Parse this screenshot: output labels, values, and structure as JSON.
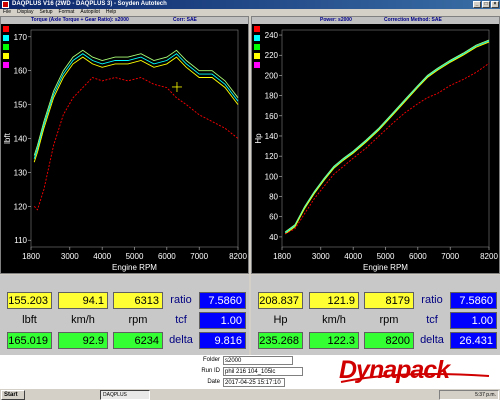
{
  "window": {
    "title": "DAQPLUS V16 (2WD - DAQPLUS 3) - Soyden Autotech"
  },
  "menu": [
    "File",
    "Display",
    "Setup",
    "Format",
    "Autopilot",
    "Help"
  ],
  "left_chart": {
    "header_title": "Torque (Axle Torque + Gear Ratio): s2000",
    "header_corr": "Corr: SAE"
  },
  "right_chart": {
    "header_title": "Power: s2000",
    "header_corr": "Correction Method: SAE"
  },
  "chart_data": [
    {
      "type": "line",
      "title": "",
      "xlabel": "Engine RPM",
      "ylabel": "lbft",
      "xlim": [
        1800,
        8200
      ],
      "ylim": [
        108,
        172
      ],
      "x_ticks": [
        1800,
        3000,
        4000,
        5000,
        6000,
        7000,
        8200
      ],
      "y_ticks": [
        110,
        120,
        130,
        140,
        150,
        160,
        170
      ],
      "legend_colors": [
        "#ff0000",
        "#00ffff",
        "#00ff00",
        "#ffff00",
        "#ff00ff"
      ],
      "series": [
        {
          "color": "#aaff77",
          "x": [
            1900,
            2000,
            2200,
            2500,
            2800,
            3100,
            3400,
            3700,
            4000,
            4400,
            4800,
            5200,
            5600,
            6000,
            6300,
            6600,
            7000,
            7400,
            7800,
            8200
          ],
          "y": [
            135,
            138,
            145,
            154,
            160,
            164,
            166,
            164,
            163,
            164,
            164,
            165,
            163,
            164,
            166,
            163,
            160,
            160,
            157,
            152
          ]
        },
        {
          "color": "#00ffff",
          "x": [
            1900,
            2000,
            2200,
            2500,
            2800,
            3100,
            3400,
            3700,
            4000,
            4400,
            4800,
            5200,
            5600,
            6000,
            6300,
            6600,
            7000,
            7400,
            7800,
            8200
          ],
          "y": [
            134,
            137,
            144,
            153,
            159,
            163,
            165,
            163,
            162,
            163,
            163,
            164,
            162,
            163,
            165,
            162,
            159,
            159,
            156,
            151
          ]
        },
        {
          "color": "#ffff00",
          "x": [
            1900,
            2000,
            2200,
            2500,
            2800,
            3100,
            3400,
            3700,
            4000,
            4400,
            4800,
            5200,
            5600,
            6000,
            6300,
            6600,
            7000,
            7400,
            7800,
            8200
          ],
          "y": [
            133,
            136,
            143,
            152,
            158,
            162,
            164,
            162,
            161,
            162,
            162,
            163,
            161,
            162,
            164,
            161,
            158,
            158,
            155,
            150
          ]
        },
        {
          "color": "#ff0000",
          "dashed": true,
          "x": [
            1900,
            2000,
            2200,
            2500,
            2800,
            3100,
            3400,
            3700,
            4000,
            4400,
            4800,
            5200,
            5600,
            6000,
            6300,
            6600,
            7000,
            7400,
            7800,
            8200
          ],
          "y": [
            120,
            119,
            125,
            138,
            147,
            152,
            155,
            158,
            157,
            158,
            157,
            158,
            156,
            155,
            152,
            150,
            147,
            145,
            143,
            140
          ]
        }
      ]
    },
    {
      "type": "line",
      "title": "",
      "xlabel": "Engine RPM",
      "ylabel": "Hp",
      "xlim": [
        1800,
        8200
      ],
      "ylim": [
        30,
        245
      ],
      "x_ticks": [
        1800,
        3000,
        4000,
        5000,
        6000,
        7000,
        8200
      ],
      "y_ticks": [
        40,
        60,
        80,
        100,
        120,
        140,
        160,
        180,
        200,
        220,
        240
      ],
      "legend_colors": [
        "#ff0000",
        "#00ffff",
        "#00ff00",
        "#ffff00",
        "#ff00ff"
      ],
      "series": [
        {
          "color": "#aaff77",
          "x": [
            1900,
            2200,
            2500,
            2800,
            3100,
            3400,
            3700,
            4000,
            4400,
            4800,
            5200,
            5600,
            6000,
            6300,
            6600,
            7000,
            7400,
            7800,
            8200
          ],
          "y": [
            45,
            52,
            70,
            85,
            98,
            110,
            118,
            125,
            136,
            148,
            162,
            176,
            190,
            200,
            207,
            215,
            222,
            230,
            235
          ]
        },
        {
          "color": "#00ffff",
          "x": [
            1900,
            2200,
            2500,
            2800,
            3100,
            3400,
            3700,
            4000,
            4400,
            4800,
            5200,
            5600,
            6000,
            6300,
            6600,
            7000,
            7400,
            7800,
            8200
          ],
          "y": [
            44,
            51,
            69,
            84,
            97,
            109,
            117,
            124,
            135,
            147,
            161,
            175,
            189,
            199,
            206,
            214,
            221,
            229,
            234
          ]
        },
        {
          "color": "#ffff00",
          "x": [
            1900,
            2200,
            2500,
            2800,
            3100,
            3400,
            3700,
            4000,
            4400,
            4800,
            5200,
            5600,
            6000,
            6300,
            6600,
            7000,
            7400,
            7800,
            8200
          ],
          "y": [
            43,
            50,
            68,
            83,
            96,
            108,
            116,
            123,
            134,
            146,
            160,
            174,
            188,
            198,
            205,
            213,
            220,
            228,
            233
          ]
        },
        {
          "color": "#ff0000",
          "dashed": true,
          "x": [
            1900,
            2200,
            2500,
            2800,
            3100,
            3400,
            3700,
            4000,
            4400,
            4800,
            5200,
            5600,
            6000,
            6300,
            6600,
            7000,
            7400,
            7800,
            8200
          ],
          "y": [
            43,
            48,
            63,
            78,
            90,
            102,
            110,
            118,
            128,
            140,
            152,
            163,
            172,
            178,
            182,
            190,
            196,
            203,
            212
          ]
        }
      ]
    }
  ],
  "left_readout": {
    "row1": [
      "155.203",
      "94.1",
      "6313"
    ],
    "units": [
      "lbft",
      "km/h",
      "rpm"
    ],
    "row3": [
      "165.019",
      "92.9",
      "6234"
    ],
    "side_labels": [
      "ratio",
      "tcf",
      "delta"
    ],
    "side_values": [
      "7.5860",
      "1.00",
      "9.816"
    ]
  },
  "right_readout": {
    "row1": [
      "208.837",
      "121.9",
      "8179"
    ],
    "units": [
      "Hp",
      "km/h",
      "rpm"
    ],
    "row3": [
      "235.268",
      "122.3",
      "8200"
    ],
    "side_labels": [
      "ratio",
      "tcf",
      "delta"
    ],
    "side_values": [
      "7.5860",
      "1.00",
      "26.431"
    ]
  },
  "info": {
    "folder_label": "Folder",
    "folder_value": "s2000",
    "run_label": "Run ID",
    "run_value": "phil 216 104_105lc",
    "date_label": "Date",
    "date_value": "2017-04-25 15:17:10"
  },
  "logo": {
    "text": "Dynapack",
    "colors": {
      "brand": "#d00000"
    }
  },
  "taskbar": {
    "start_label": "Start",
    "task_label": "DAQPLUS",
    "clock": "5:37 p.m."
  }
}
